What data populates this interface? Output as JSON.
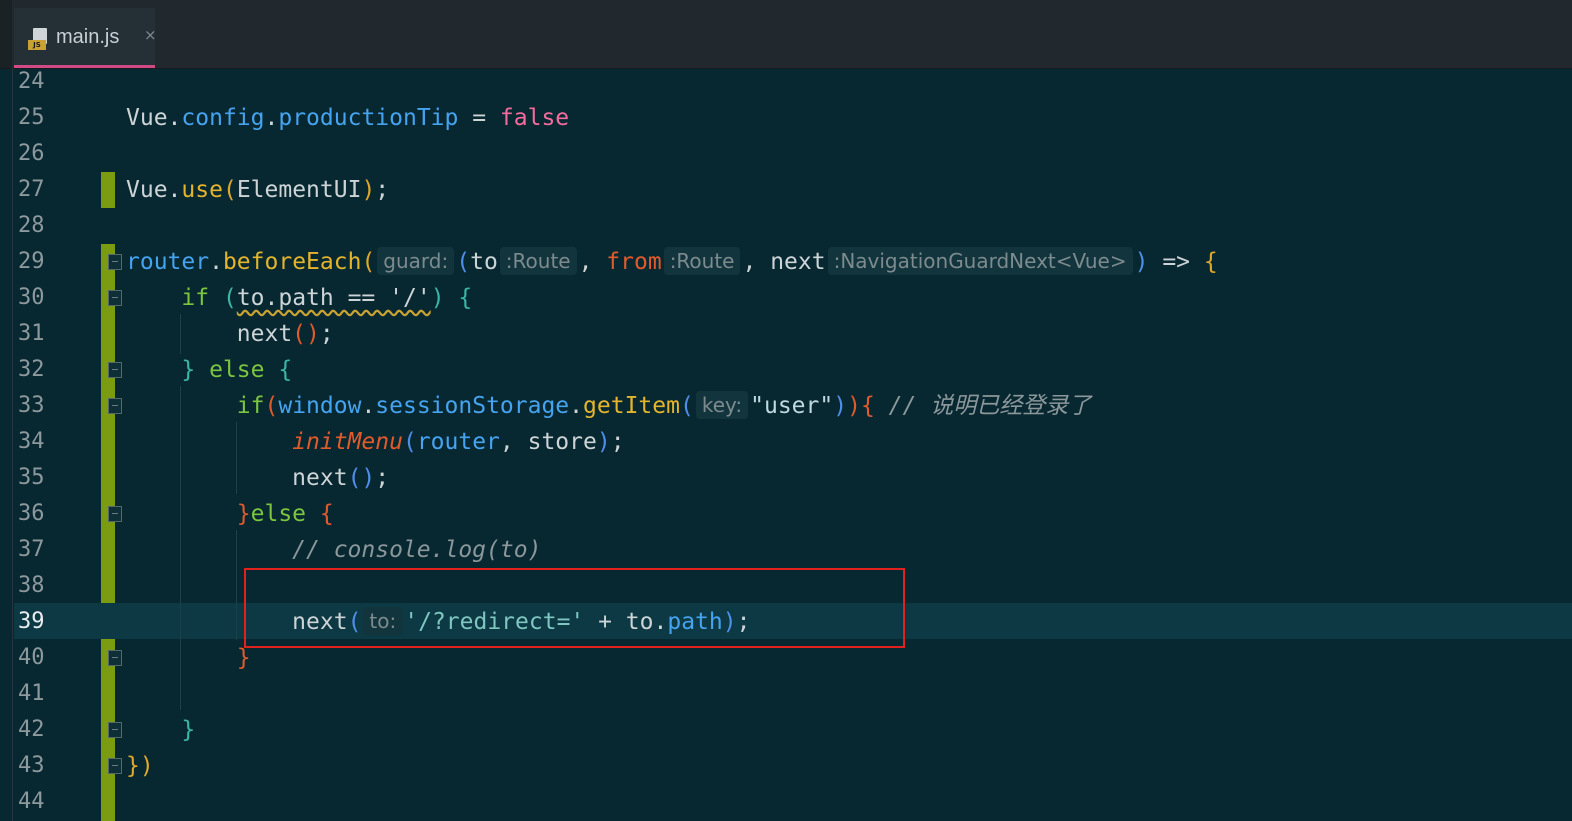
{
  "tab": {
    "file_name": "main.js",
    "file_type_label": "JS",
    "close_glyph": "×"
  },
  "editor": {
    "current_line": "39",
    "lines": [
      {
        "n": "24"
      },
      {
        "n": "25",
        "t": [
          "Vue",
          ".",
          "config",
          ".",
          "productionTip",
          " = ",
          "false"
        ]
      },
      {
        "n": "26"
      },
      {
        "n": "27",
        "t": [
          "Vue",
          ".",
          "use",
          "(",
          "ElementUI",
          ")",
          ";"
        ]
      },
      {
        "n": "28"
      },
      {
        "n": "29",
        "t": [
          "router",
          ".",
          "beforeEach",
          "(",
          "guard:",
          "(",
          "to",
          ":Route",
          ", ",
          "from",
          ":Route",
          ", ",
          "next",
          ":NavigationGuardNext<Vue>",
          ")",
          " => ",
          "{"
        ]
      },
      {
        "n": "30",
        "t": [
          "    ",
          "if",
          " ",
          "(",
          "to.path == '/'",
          ")",
          " ",
          "{"
        ]
      },
      {
        "n": "31",
        "t": [
          "        ",
          "next",
          "(",
          ")",
          ";"
        ]
      },
      {
        "n": "32",
        "t": [
          "    ",
          "}",
          " ",
          "else",
          " ",
          "{"
        ]
      },
      {
        "n": "33",
        "t": [
          "        ",
          "if",
          "(",
          "window",
          ".",
          "sessionStorage",
          ".",
          "getItem",
          "(",
          "key:",
          "\"user\"",
          ")",
          ")",
          "{",
          " ",
          "// 说明已经登录了"
        ]
      },
      {
        "n": "34",
        "t": [
          "            ",
          "initMenu",
          "(",
          "router",
          ", store",
          ")",
          ";"
        ]
      },
      {
        "n": "35",
        "t": [
          "            ",
          "next",
          "(",
          ")",
          ";"
        ]
      },
      {
        "n": "36",
        "t": [
          "        ",
          "}",
          "else",
          " ",
          "{"
        ]
      },
      {
        "n": "37",
        "t": [
          "            ",
          "// console.log(to)"
        ]
      },
      {
        "n": "38"
      },
      {
        "n": "39",
        "t": [
          "            ",
          "next",
          "(",
          "to:",
          "'/?redirect='",
          " + to.",
          "path",
          ")",
          ";"
        ]
      },
      {
        "n": "40",
        "t": [
          "        ",
          "}"
        ]
      },
      {
        "n": "41"
      },
      {
        "n": "42",
        "t": [
          "    ",
          "}"
        ]
      },
      {
        "n": "43",
        "t": [
          "}",
          ")"
        ]
      },
      {
        "n": "44"
      }
    ]
  },
  "colors": {
    "background": "#072831",
    "current_line": "#0c3943",
    "vcs_modified": "#7b9c10",
    "tab_underline": "#d04a86",
    "annotation_box": "#e0221f"
  }
}
